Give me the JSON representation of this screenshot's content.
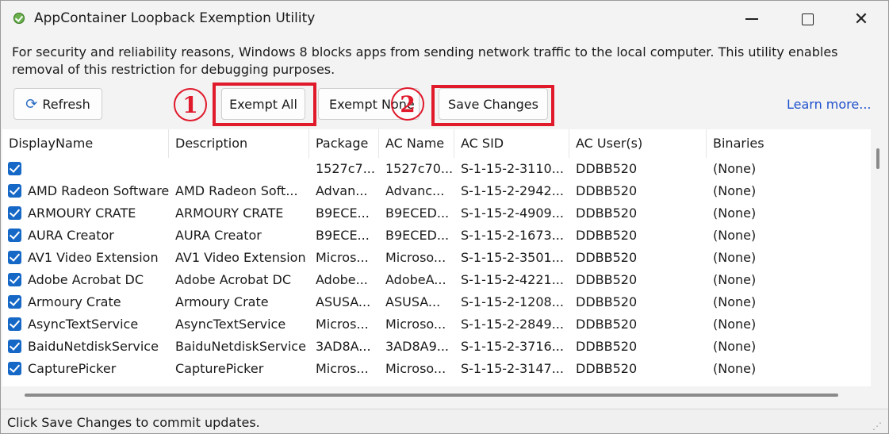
{
  "window": {
    "title": "AppContainer Loopback Exemption Utility",
    "minimize_icon": "minimize-icon",
    "maximize_icon": "maximize-icon",
    "close_glyph": "✕"
  },
  "description": "For security and reliability reasons, Windows 8 blocks apps from sending network traffic to the local computer. This utility enables removal of this restriction for debugging purposes.",
  "toolbar": {
    "refresh_label": "Refresh",
    "refresh_icon": "refresh-icon",
    "exempt_all_label": "Exempt All",
    "exempt_none_label": "Exempt None",
    "save_label": "Save Changes",
    "learn_more": "Learn more...",
    "step1": "1",
    "step2": "2",
    "highlight_color": "#e0192b"
  },
  "table": {
    "columns": [
      "DisplayName",
      "Description",
      "Package",
      "AC Name",
      "AC SID",
      "AC User(s)",
      "Binaries"
    ],
    "rows": [
      {
        "checked": true,
        "display": "",
        "desc": "",
        "package": "1527c7...",
        "acname": "1527c70...",
        "sid": "S-1-15-2-3110...",
        "user": "DDBB520",
        "bin": "(None)"
      },
      {
        "checked": true,
        "display": "AMD Radeon Software",
        "desc": "AMD Radeon Soft...",
        "package": "Advan...",
        "acname": "Advanc...",
        "sid": "S-1-15-2-2942...",
        "user": "DDBB520",
        "bin": "(None)"
      },
      {
        "checked": true,
        "display": "ARMOURY CRATE",
        "desc": "ARMOURY CRATE",
        "package": "B9ECE...",
        "acname": "B9ECED...",
        "sid": "S-1-15-2-4909...",
        "user": "DDBB520",
        "bin": "(None)"
      },
      {
        "checked": true,
        "display": "AURA Creator",
        "desc": "AURA Creator",
        "package": "B9ECE...",
        "acname": "B9ECED...",
        "sid": "S-1-15-2-1673...",
        "user": "DDBB520",
        "bin": "(None)"
      },
      {
        "checked": true,
        "display": "AV1 Video Extension",
        "desc": "AV1 Video Extension",
        "package": "Micros...",
        "acname": "Microso...",
        "sid": "S-1-15-2-3501...",
        "user": "DDBB520",
        "bin": "(None)"
      },
      {
        "checked": true,
        "display": "Adobe Acrobat DC",
        "desc": "Adobe Acrobat DC",
        "package": "Adobe...",
        "acname": "AdobeA...",
        "sid": "S-1-15-2-4221...",
        "user": "DDBB520",
        "bin": "(None)"
      },
      {
        "checked": true,
        "display": "Armoury Crate",
        "desc": "Armoury Crate",
        "package": "ASUSA...",
        "acname": "ASUSA...",
        "sid": "S-1-15-2-1208...",
        "user": "DDBB520",
        "bin": "(None)"
      },
      {
        "checked": true,
        "display": "AsyncTextService",
        "desc": "AsyncTextService",
        "package": "Micros...",
        "acname": "Microso...",
        "sid": "S-1-15-2-2849...",
        "user": "DDBB520",
        "bin": "(None)"
      },
      {
        "checked": true,
        "display": "BaiduNetdiskService",
        "desc": "BaiduNetdiskService",
        "package": "3AD8A...",
        "acname": "3AD8A9...",
        "sid": "S-1-15-2-3716...",
        "user": "DDBB520",
        "bin": "(None)"
      },
      {
        "checked": true,
        "display": "CapturePicker",
        "desc": "CapturePicker",
        "package": "Micros...",
        "acname": "Microso...",
        "sid": "S-1-15-2-3147...",
        "user": "DDBB520",
        "bin": "(None)"
      }
    ]
  },
  "status": {
    "text": "Click Save Changes to commit updates."
  }
}
